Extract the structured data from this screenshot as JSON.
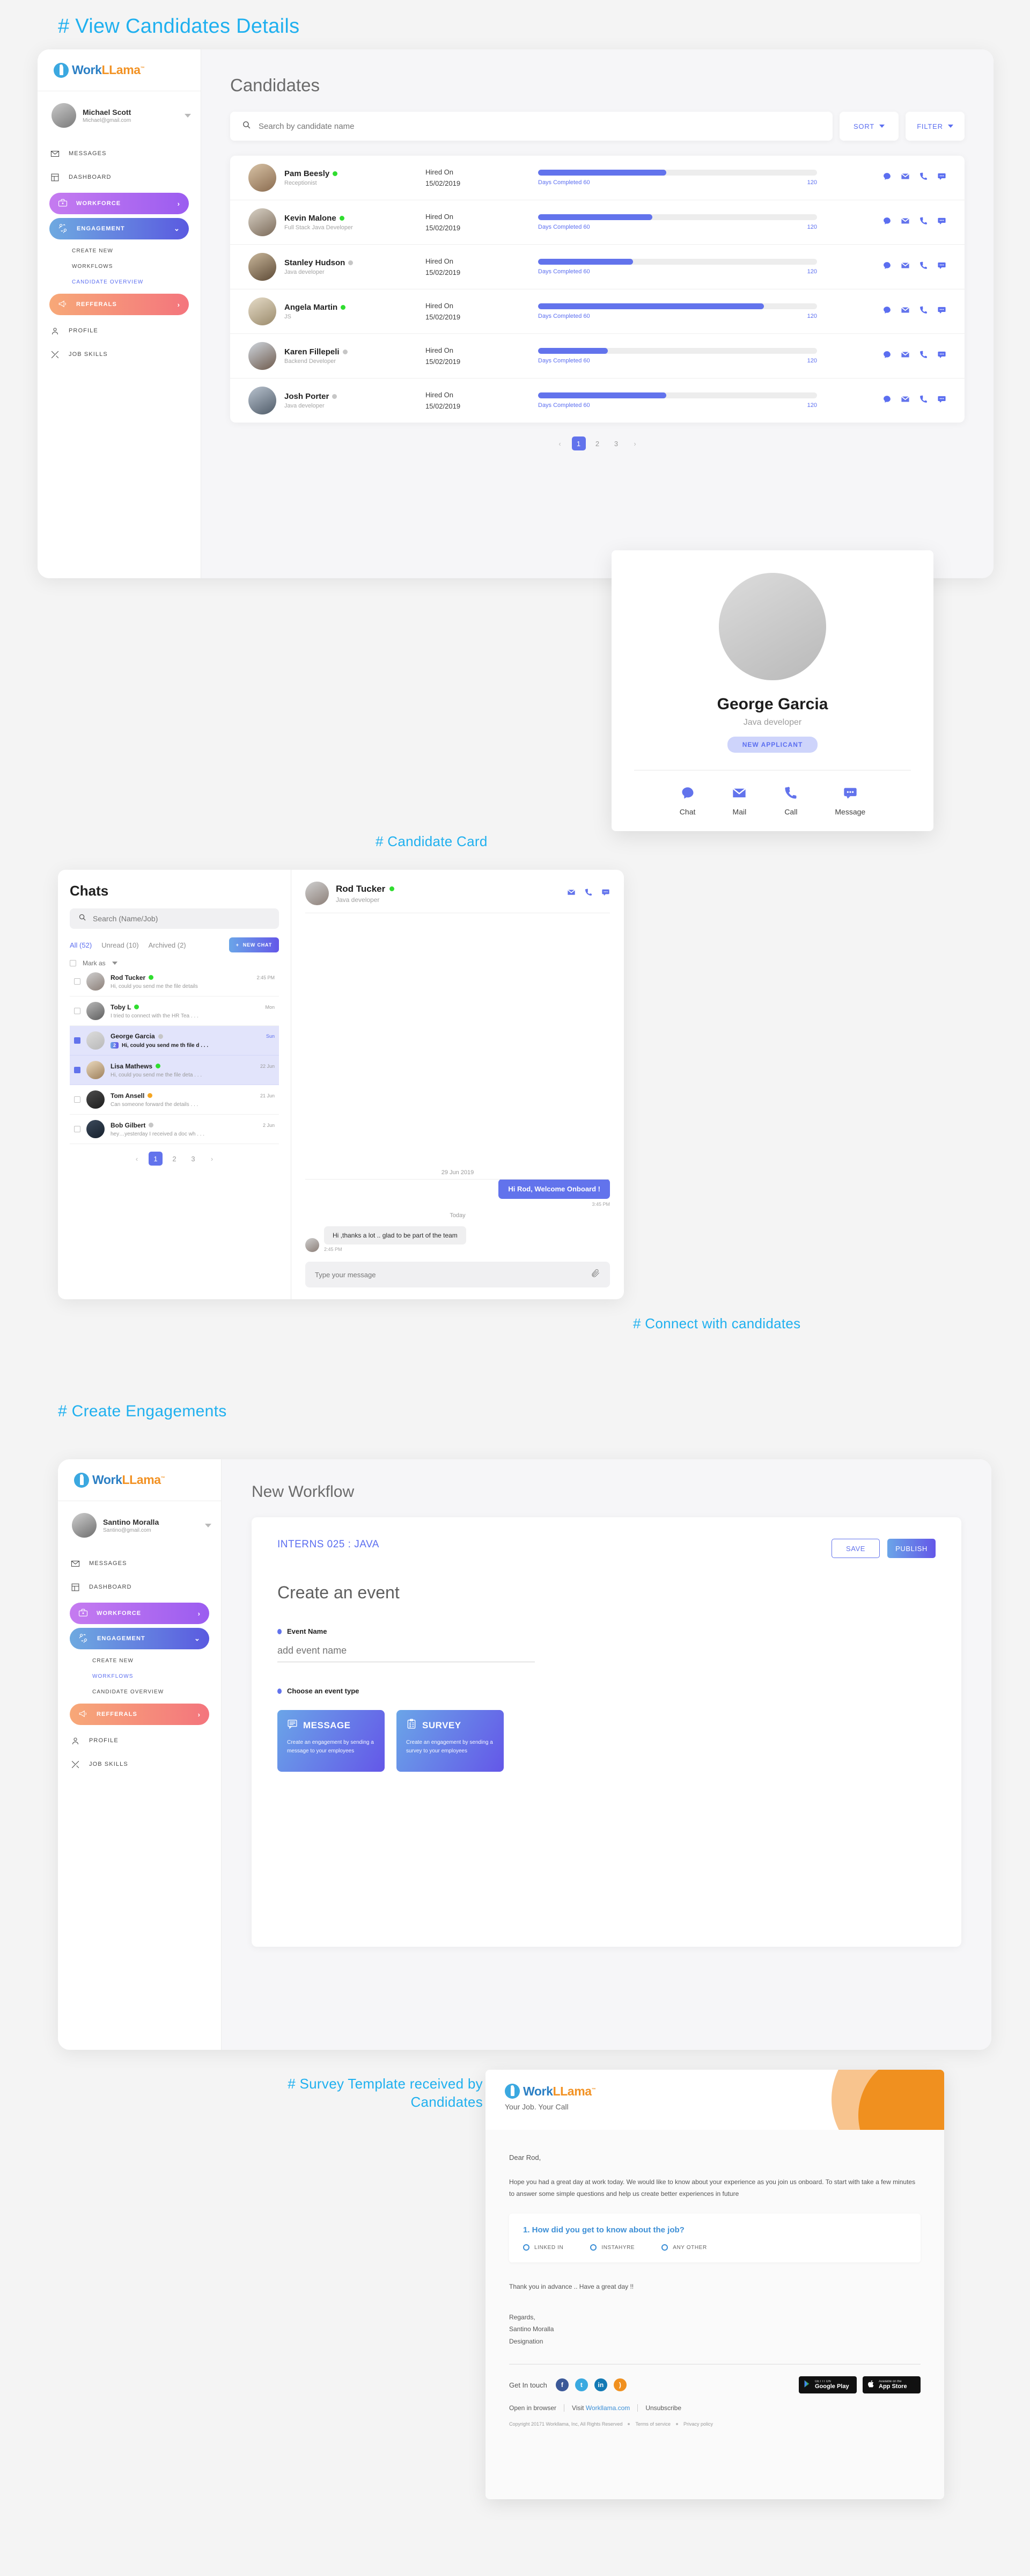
{
  "brand": {
    "name_part1": "Work",
    "name_part2": "LLama",
    "tm": "™",
    "tagline": "Your Job. Your Call"
  },
  "headings": {
    "candidates": "# View Candidates Details",
    "candidate_card": "# Candidate Card",
    "connect": "# Connect with candidates",
    "engagements": "# Create Engagements",
    "survey": "# Survey Template received by Candidates"
  },
  "sidebar_candidates": {
    "user": {
      "name": "Michael Scott",
      "email": "Michael@gmail.com"
    },
    "items": [
      {
        "label": "MESSAGES",
        "icon": "mail-icon"
      },
      {
        "label": "DASHBOARD",
        "icon": "dashboard-icon"
      }
    ],
    "workforce": {
      "label": "WORKFORCE",
      "chevron": "›"
    },
    "engagement": {
      "label": "ENGAGEMENT",
      "chevron": "⌄"
    },
    "sub_items": [
      {
        "label": "CREATE NEW",
        "active": false
      },
      {
        "label": "WORKFLOWS",
        "active": false
      },
      {
        "label": "CANDIDATE OVERVIEW",
        "active": true
      }
    ],
    "referrals": {
      "label": "REFFERALS",
      "chevron": "›"
    },
    "bottom_items": [
      {
        "label": "PROFILE",
        "icon": "user-icon"
      },
      {
        "label": "JOB SKILLS",
        "icon": "skills-icon"
      }
    ]
  },
  "sidebar_engagement": {
    "user": {
      "name": "Santino Moralla",
      "email": "Santino@gmail.com"
    },
    "items": [
      {
        "label": "MESSAGES",
        "icon": "mail-icon"
      },
      {
        "label": "DASHBOARD",
        "icon": "dashboard-icon"
      }
    ],
    "workforce": {
      "label": "WORKFORCE",
      "chevron": "›"
    },
    "engagement": {
      "label": "ENGAGEMENT",
      "chevron": "⌄"
    },
    "sub_items": [
      {
        "label": "CREATE NEW",
        "active": false
      },
      {
        "label": "WORKFLOWS",
        "active": true
      },
      {
        "label": "CANDIDATE OVERVIEW",
        "active": false
      }
    ],
    "referrals": {
      "label": "REFFERALS",
      "chevron": "›"
    },
    "bottom_items": [
      {
        "label": "PROFILE",
        "icon": "user-icon"
      },
      {
        "label": "JOB SKILLS",
        "icon": "skills-icon"
      }
    ]
  },
  "candidates_page": {
    "title": "Candidates",
    "search_placeholder": "Search by candidate name",
    "sort_label": "SORT",
    "filter_label": "FILTER",
    "hired_on_label": "Hired On",
    "rows": [
      {
        "name": "Pam Beesly",
        "role": "Receptionist",
        "status": "online",
        "hired_on": "15/02/2019",
        "progress_label": "Days Completed 60",
        "total": "120",
        "percent": 46,
        "avatar": "av-pam"
      },
      {
        "name": "Kevin Malone",
        "role": "Full Stack Java Developer",
        "status": "online",
        "hired_on": "15/02/2019",
        "progress_label": "Days Completed 60",
        "total": "120",
        "percent": 41,
        "avatar": "av-kevin"
      },
      {
        "name": "Stanley Hudson",
        "role": "Java developer",
        "status": "offline",
        "hired_on": "15/02/2019",
        "progress_label": "Days Completed 60",
        "total": "120",
        "percent": 34,
        "avatar": "av-stanley"
      },
      {
        "name": "Angela Martin",
        "role": "JS",
        "status": "online",
        "hired_on": "15/02/2019",
        "progress_label": "Days Completed 60",
        "total": "120",
        "percent": 81,
        "avatar": "av-angela"
      },
      {
        "name": "Karen Fillepeli",
        "role": "Backend Developer",
        "status": "offline",
        "hired_on": "15/02/2019",
        "progress_label": "Days Completed 60",
        "total": "120",
        "percent": 25,
        "avatar": "av-karen"
      },
      {
        "name": "Josh Porter",
        "role": "Java developer",
        "status": "offline",
        "hired_on": "15/02/2019",
        "progress_label": "Days Completed 60",
        "total": "120",
        "percent": 46,
        "avatar": "av-josh"
      }
    ],
    "pagination": {
      "prev": "‹",
      "pages": [
        "1",
        "2",
        "3"
      ],
      "next": "›",
      "current": "1"
    }
  },
  "candidate_card": {
    "name": "George Garcia",
    "role": "Java developer",
    "badge": "NEW APPLICANT",
    "actions": [
      {
        "label": "Chat",
        "icon": "chat-icon"
      },
      {
        "label": "Mail",
        "icon": "mail-icon"
      },
      {
        "label": "Call",
        "icon": "phone-icon"
      },
      {
        "label": "Message",
        "icon": "message-icon"
      }
    ]
  },
  "chats": {
    "title": "Chats",
    "search_placeholder": "Search (Name/Job)",
    "tabs": [
      {
        "label": "All (52)",
        "active": true
      },
      {
        "label": "Unread (10)",
        "active": false
      },
      {
        "label": "Archived  (2)",
        "active": false
      }
    ],
    "new_chat_label": "NEW CHAT",
    "mark_as_label": "Mark as",
    "items": [
      {
        "name": "Rod Tucker",
        "status": "online",
        "time": "2:45 PM",
        "preview": "Hi, could you send me the file details",
        "selected": false,
        "unread": null,
        "avatar": "av-rod"
      },
      {
        "name": "Toby L",
        "status": "online",
        "time": "Mon",
        "preview": "I tried to connect with the HR Tea . . .",
        "selected": false,
        "unread": null,
        "avatar": "av-toby"
      },
      {
        "name": "George Garcia",
        "status": "offline",
        "time": "Sun",
        "preview": "Hi, could you send me th file d . . .",
        "selected": true,
        "unread": "2",
        "avatar": "av-george"
      },
      {
        "name": "Lisa Mathews",
        "status": "online",
        "time": "22 Jun",
        "preview": "Hi, could you send me the file deta . . .",
        "selected": true,
        "unread": null,
        "avatar": "av-lisa"
      },
      {
        "name": "Tom Ansell",
        "status": "away",
        "time": "21 Jun",
        "preview": "Can someone forward the details . . .",
        "selected": false,
        "unread": null,
        "avatar": "av-tom"
      },
      {
        "name": "Bob Gilbert",
        "status": "offline",
        "time": "2 Jun",
        "preview": "hey…yesterday I received a doc wh . . .",
        "selected": false,
        "unread": null,
        "avatar": "av-bob"
      }
    ],
    "pagination": {
      "prev": "‹",
      "pages": [
        "1",
        "2",
        "3"
      ],
      "next": "›",
      "current": "1"
    },
    "conversation": {
      "name": "Rod Tucker",
      "role": "Java developer",
      "status": "online",
      "date_separator": "29 Jun 2019",
      "today_separator": "Today",
      "outgoing": {
        "text": "Hi Rod, Welcome Onboard !",
        "time": "3:45 PM"
      },
      "incoming": {
        "text": "Hi ,thanks a lot .. glad to be part of the team",
        "time": "2:45 PM"
      },
      "input_placeholder": "Type your message"
    }
  },
  "workflow": {
    "page_title": "New Workflow",
    "breadcrumb": "INTERNS 025 : JAVA",
    "save_label": "SAVE",
    "publish_label": "PUBLISH",
    "heading": "Create an event",
    "event_name_label": "Event Name",
    "event_name_placeholder": "add event name",
    "event_type_label": "Choose an event type",
    "event_types": [
      {
        "title": "MESSAGE",
        "desc": "Create an engagement by sending a message to your employees",
        "icon": "message-lines-icon"
      },
      {
        "title": "SURVEY",
        "desc": "Create an engagement by sending a survey to your employees",
        "icon": "clipboard-icon"
      }
    ]
  },
  "email": {
    "greeting": "Dear Rod,",
    "body": "Hope you had a great day at work today. We would like to know about your experience as you join us onboard. To start with take a few minutes to answer some simple questions and help us create better experiences in future",
    "question": "1. How did you get to know about the job?",
    "options": [
      "LINKED IN",
      "INSTAHYRE",
      "ANY OTHER"
    ],
    "thanks": "Thank you in advance .. Have a great day !!",
    "sign_regards": "Regards,",
    "sign_name": "Santino Moralla",
    "sign_title": "Designation",
    "get_in_touch": "Get In touch",
    "socials": [
      "facebook-icon",
      "twitter-icon",
      "linkedin-icon",
      "rss-icon"
    ],
    "stores": [
      {
        "small": "GET IT ON",
        "big": "Google Play"
      },
      {
        "small": "Available on the",
        "big": "App Store"
      }
    ],
    "links": {
      "open": "Open in browser",
      "visit_prefix": "Visit ",
      "visit_link": "Workllama.com",
      "unsubscribe": "Unsubscribe"
    },
    "copyright": "Copyright 20171 Workllama, Inc, All Rights Reserved",
    "terms": "Terms of service",
    "privacy": "Privacy policy"
  }
}
